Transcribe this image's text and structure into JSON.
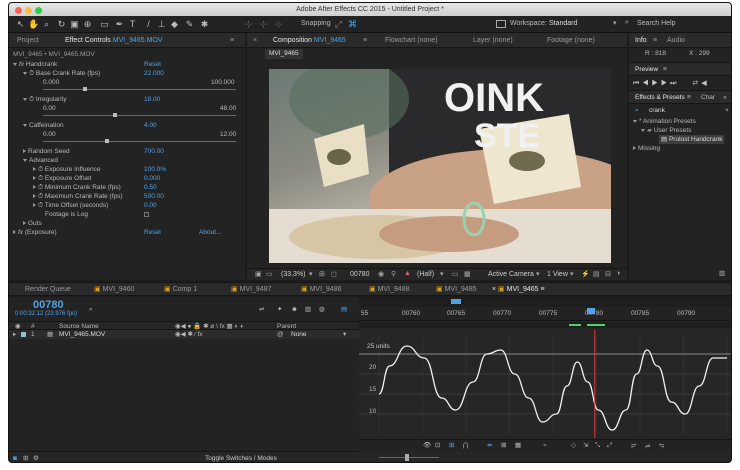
{
  "window": {
    "title": "Adobe After Effects CC 2015 - Untitled Project *"
  },
  "toolbar": {
    "snapping_label": "Snapping",
    "workspace_label": "Workspace:",
    "workspace_value": "Standard",
    "search_placeholder": "Search Help"
  },
  "project_panel": {
    "tab_project": "Project",
    "tab_effect_controls_prefix": "Effect Controls",
    "tab_effect_controls_file": "MVI_9465.MOV",
    "breadcrumb": "MVI_9465 • MVI_9465.MOV"
  },
  "effect_controls": {
    "handcrank": {
      "name": "Handcrank",
      "reset": "Reset"
    },
    "base_crank": {
      "label": "Base Crank Rate (fps)",
      "value": "22.000",
      "min": "0.000",
      "max": "100.000",
      "level": 0.22
    },
    "irregularity": {
      "label": "Irregularity",
      "value": "18.00",
      "min": "0.00",
      "max": "48.00",
      "level": 0.375
    },
    "caffeination": {
      "label": "Caffeination",
      "value": "4.00",
      "min": "0.00",
      "max": "12.00",
      "level": 0.333
    },
    "random_seed": {
      "label": "Random Seed",
      "value": "700.00"
    },
    "advanced": {
      "label": "Advanced"
    },
    "exposure_influence": {
      "label": "Exposure Influence",
      "value": "100.0%"
    },
    "exposure_offset": {
      "label": "Exposure Offset",
      "value": "0.000"
    },
    "min_crank": {
      "label": "Minimum Crank Rate (fps)",
      "value": "0.50"
    },
    "max_crank": {
      "label": "Maximum Crank Rate (fps)",
      "value": "500.00"
    },
    "time_offset": {
      "label": "Time Offset (seconds)",
      "value": "0.00"
    },
    "footage_log": {
      "label": "Footage is Log"
    },
    "guts": {
      "label": "Guts"
    },
    "exposure": {
      "name": "(Exposure)",
      "reset": "Reset",
      "about": "About..."
    }
  },
  "composition_panel": {
    "tab_prefix": "Composition",
    "tab_name": "MVI_9465",
    "tab_flowchart": "Flowchart (none)",
    "tab_layer": "Layer (none)",
    "tab_footage": "Footage (none)",
    "subtab": "MVI_9465",
    "frame_text": "OINK STE",
    "zoom": "(33.3%)",
    "timecode": "00780",
    "resolution": "(Half)",
    "camera": "Active Camera",
    "views": "1 View"
  },
  "info_panel": {
    "tab_info": "Info",
    "tab_audio": "Audio",
    "r_value": "R : 818",
    "x_value": "X : 299"
  },
  "preview_panel": {
    "title": "Preview"
  },
  "effects_presets": {
    "title": "Effects & Presets",
    "tab_char": "Char",
    "search_value": "crank",
    "tree": [
      "* Animation Presets",
      "User Presets",
      "Prolost Handcrank",
      "Missing"
    ]
  },
  "timeline_tabs": [
    "Render Queue",
    "MVI_9460",
    "Comp 1",
    "MVI_9487",
    "MVI_9486",
    "MVI_9488",
    "MVI_9485",
    "MVI_9465"
  ],
  "timeline": {
    "timecode": "00780",
    "timecode_sub": "0:00:32:12 (23.976 fps)",
    "col_source": "Source Name",
    "col_parent": "Parent",
    "layer_index": "1",
    "layer_name": "MVI_9465.MOV",
    "parent_value": "None",
    "ruler": [
      "55",
      "00760",
      "00765",
      "00770",
      "00775",
      "00780",
      "00785",
      "00790"
    ],
    "graph_unit": "25 units",
    "graph_ticks": [
      "20",
      "15",
      "10"
    ],
    "toggle_label": "Toggle Switches / Modes"
  },
  "graph_data": {
    "y_range": [
      5,
      30
    ],
    "points": [
      [
        0,
        15
      ],
      [
        0.03,
        22
      ],
      [
        0.08,
        27
      ],
      [
        0.13,
        24
      ],
      [
        0.18,
        14
      ],
      [
        0.22,
        11
      ],
      [
        0.27,
        18
      ],
      [
        0.31,
        25
      ],
      [
        0.35,
        26
      ],
      [
        0.39,
        20
      ],
      [
        0.43,
        14
      ],
      [
        0.47,
        8
      ],
      [
        0.51,
        10
      ],
      [
        0.54,
        17
      ],
      [
        0.57,
        23
      ],
      [
        0.6,
        18
      ],
      [
        0.63,
        11
      ],
      [
        0.67,
        6
      ],
      [
        0.71,
        11
      ],
      [
        0.74,
        20
      ],
      [
        0.77,
        26
      ],
      [
        0.8,
        22
      ],
      [
        0.84,
        13
      ],
      [
        0.88,
        10
      ],
      [
        0.92,
        17
      ],
      [
        0.96,
        24
      ],
      [
        1,
        24
      ]
    ],
    "playhead": 0.62
  },
  "colors": {
    "accent": "#4fa3ea",
    "playhead": "#e03a3a",
    "graph_line": "#f1f1f1"
  }
}
